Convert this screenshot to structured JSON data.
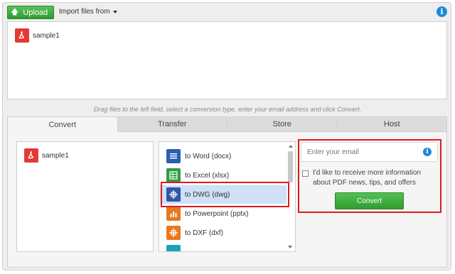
{
  "header": {
    "upload_label": "Upload",
    "import_label": "Import files from"
  },
  "drop_area": {
    "file_name": "sample1"
  },
  "hint": "Drag files to the left field, select a conversion type, enter your email address and click Convert.",
  "tabs": [
    {
      "label": "Convert",
      "active": true
    },
    {
      "label": "Transfer",
      "active": false
    },
    {
      "label": "Store",
      "active": false
    },
    {
      "label": "Host",
      "active": false
    }
  ],
  "left_panel": {
    "file_name": "sample1"
  },
  "conversions": [
    {
      "label": "to Word (docx)",
      "icon": "word-document-icon",
      "color": "#2b5fb4",
      "selected": false
    },
    {
      "label": "to Excel (xlsx)",
      "icon": "excel-sheet-icon",
      "color": "#2f9e44",
      "selected": false
    },
    {
      "label": "to DWG (dwg)",
      "icon": "dwg-crosshair-icon",
      "color": "#2f57a5",
      "selected": true
    },
    {
      "label": "to Powerpoint (pptx)",
      "icon": "powerpoint-chart-icon",
      "color": "#e8791e",
      "selected": false
    },
    {
      "label": "to DXF (dxf)",
      "icon": "dxf-crosshair-icon",
      "color": "#e8791e",
      "selected": false
    }
  ],
  "email": {
    "placeholder": "Enter your email",
    "checkbox_label": "I'd like to receive more information about PDF news, tips, and offers",
    "checked": false
  },
  "convert_label": "Convert",
  "colors": {
    "accent_green": "#3aa83a",
    "highlight_red": "#e01b1b",
    "info_blue": "#1e88d8",
    "selection_blue": "#cfe0f7"
  }
}
